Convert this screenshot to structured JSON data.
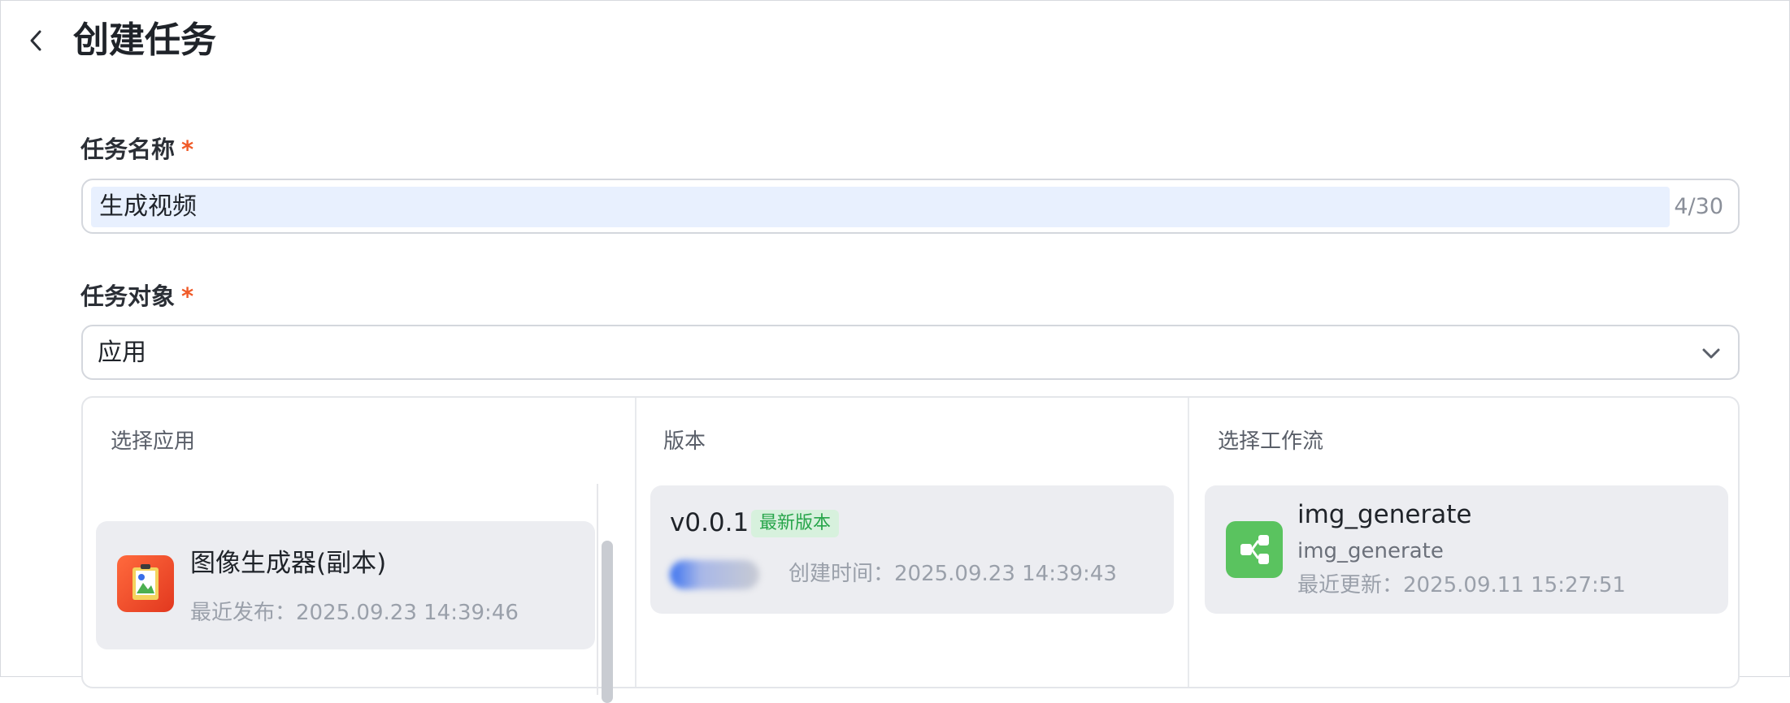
{
  "header": {
    "title": "创建任务"
  },
  "form": {
    "task_name": {
      "label": "任务名称",
      "required_mark": "*",
      "value": "生成视频",
      "counter": "4/30"
    },
    "task_target": {
      "label": "任务对象",
      "required_mark": "*",
      "selected": "应用"
    }
  },
  "columns": {
    "app": {
      "header": "选择应用",
      "items": [
        {
          "name": "图像生成器(副本)",
          "published": "最近发布：2025.09.23 14:39:46"
        }
      ]
    },
    "version": {
      "header": "版本",
      "items": [
        {
          "version": "v0.0.1",
          "badge": "最新版本",
          "created": "创建时间：2025.09.23 14:39:43"
        }
      ]
    },
    "workflow": {
      "header": "选择工作流",
      "items": [
        {
          "name": "img_generate",
          "id": "img_generate",
          "updated": "最近更新：2025.09.11 15:27:51"
        }
      ]
    }
  },
  "colors": {
    "required": "#f05a28",
    "badge_text": "#27a54a",
    "badge_bg": "#d7f1dd",
    "workflow_icon": "#5ac35f",
    "app_icon": "#e2381f"
  },
  "icons": {
    "back": "chevron-left-icon",
    "select": "chevron-down-icon",
    "app": "image-app-icon",
    "workflow": "workflow-nodes-icon"
  }
}
